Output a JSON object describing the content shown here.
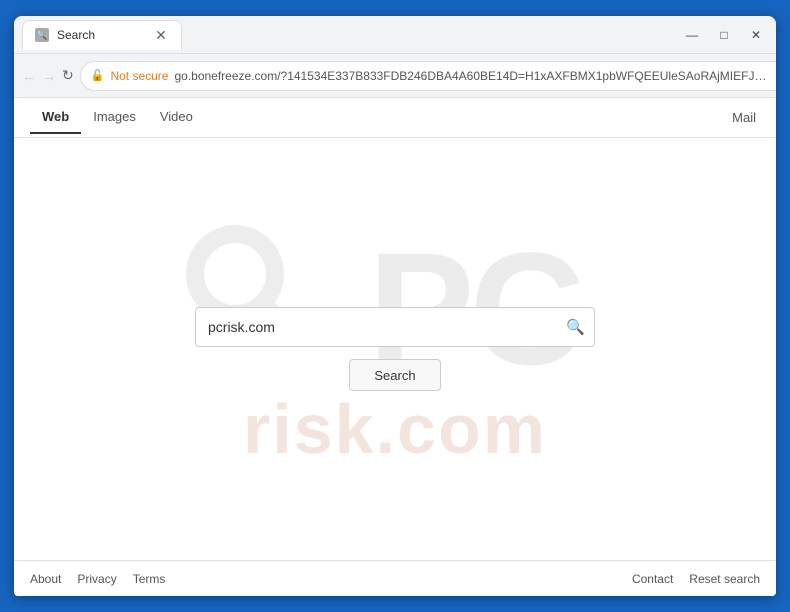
{
  "browser": {
    "tab_title": "Search",
    "tab_favicon": "🔍",
    "address_bar": {
      "security_label": "Not secure",
      "url": "go.bonefreeze.com/?141534E337B833FDB246DBA4A60BE14D=H1xAXFBMX1pbWFQEEUleSAoRAjMIEFJfX1h..."
    },
    "window_controls": {
      "minimize": "—",
      "maximize": "□",
      "close": "✕"
    }
  },
  "nav": {
    "tabs": [
      {
        "label": "Web",
        "active": true
      },
      {
        "label": "Images",
        "active": false
      },
      {
        "label": "Video",
        "active": false
      }
    ],
    "mail_label": "Mail"
  },
  "search": {
    "input_value": "pcrisk.com",
    "button_label": "Search"
  },
  "watermark": {
    "top_text": "PC",
    "bottom_text": "risk.com"
  },
  "footer": {
    "links": [
      "About",
      "Privacy",
      "Terms"
    ],
    "right_links": [
      "Contact",
      "Reset search"
    ]
  }
}
